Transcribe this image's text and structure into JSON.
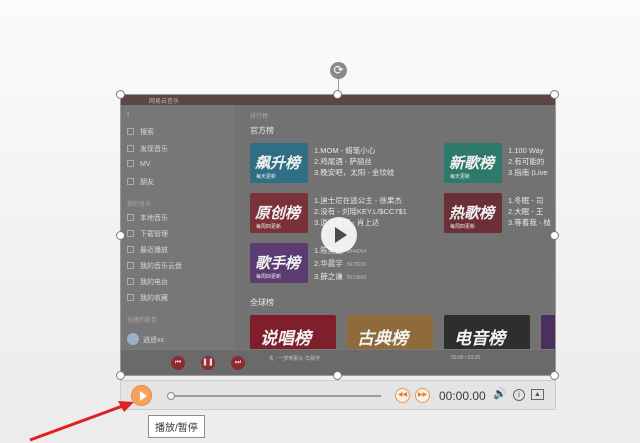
{
  "app_title": "网易云音乐",
  "sidebar": {
    "items": [
      {
        "label": "搜索"
      },
      {
        "label": "发现音乐"
      },
      {
        "label": "MV"
      },
      {
        "label": "朋友"
      }
    ],
    "my_music_header": "我的音乐",
    "my_items": [
      {
        "label": "本地音乐"
      },
      {
        "label": "下载管理"
      },
      {
        "label": "最近播放"
      },
      {
        "label": "我的音乐云盘"
      },
      {
        "label": "我的电台"
      },
      {
        "label": "我的收藏"
      }
    ],
    "created_header": "创建的歌单",
    "user": "逍遥xx"
  },
  "content": {
    "top_label": "排行榜",
    "official_title": "官方榜",
    "global_title": "全球榜",
    "cards": [
      {
        "name": "飙升榜",
        "sub": "每天更新"
      },
      {
        "name": "新歌榜",
        "sub": "每天更新"
      },
      {
        "name": "原创榜",
        "sub": "每周四更新"
      },
      {
        "name": "热歌榜",
        "sub": "每周四更新"
      },
      {
        "name": "歌手榜",
        "sub": "每周四更新"
      }
    ],
    "list_a": [
      "1.MOM - 蜡笔小心",
      "2.鸡尾酒 - 萨丽丝",
      "3.晚安吧，太阳 - 金玟岐"
    ],
    "list_b": [
      "1.100 Way",
      "2.有可能的",
      "3.指南 (Live"
    ],
    "list_c": [
      "1.迪士尼在逃公主 - 徐果杰",
      "2.没有 - 刘瑶KEY.L/$CC7$1",
      "3.逍遥日记 - 肖上达"
    ],
    "list_d": [
      "1.冬眠 - 司",
      "2.大眠 - 王",
      "3.等着我 - 枝"
    ],
    "list_e": [
      {
        "name": "1.陈奕迅",
        "sub": "5944094"
      },
      {
        "name": "2.华晨宇",
        "sub": "5678210"
      },
      {
        "name": "3.薛之谦",
        "sub": "5019850"
      }
    ],
    "global_cards": [
      {
        "name": "说唱榜"
      },
      {
        "name": "古典榜"
      },
      {
        "name": "电音榜"
      }
    ]
  },
  "player_bar": {
    "song": "失 - 一梦到那头·华晨宇",
    "time": "00:00 / 03:26"
  },
  "controls": {
    "time": "00:00.00"
  },
  "tooltip": "播放/暂停",
  "colors": {
    "accent": "#f7a25b",
    "netease_red": "#8b2c32",
    "arrow": "#e02020"
  }
}
